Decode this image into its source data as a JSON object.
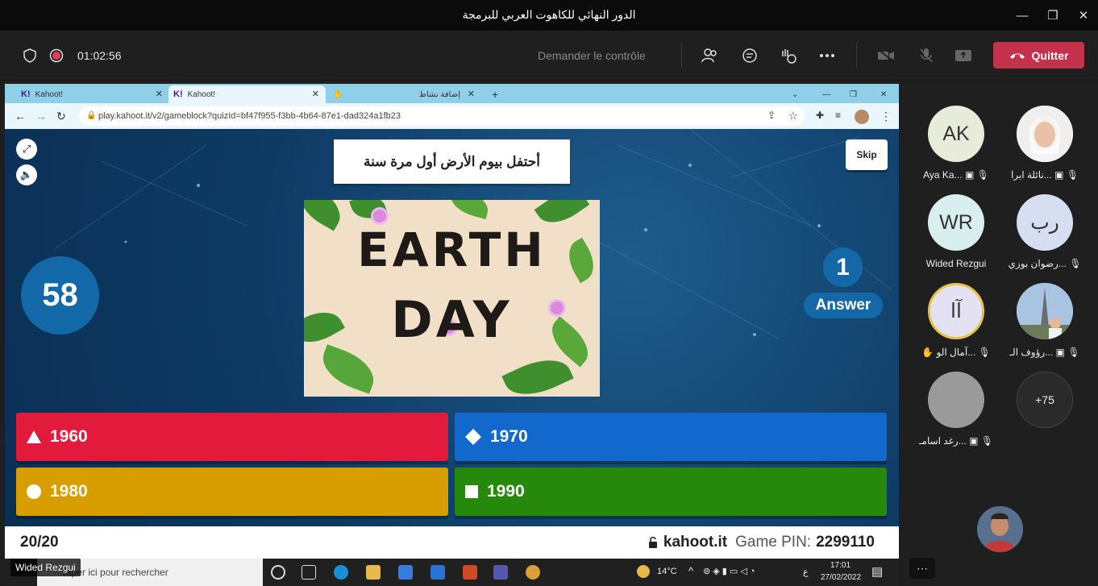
{
  "window": {
    "title": "الدور النهائي للكاهوت العربي للبرمجة"
  },
  "meeting": {
    "timer": "01:02:56",
    "request_control": "Demander le contrôle",
    "quit_label": "Quitter"
  },
  "browser": {
    "tabs": [
      {
        "label": "Kahoot!"
      },
      {
        "label": "Kahoot!"
      },
      {
        "label": "إضافة نشاط"
      }
    ],
    "url": "play.kahoot.it/v2/gameblock?quizId=bf47f955-f3bb-4b64-87e1-dad324a1fb23"
  },
  "kahoot": {
    "question": "أحتفل بيوم الأرض أول مرة سنة",
    "skip_label": "Skip",
    "timer_value": "58",
    "answer_count": "1",
    "answer_label": "Answer",
    "image_words": [
      "EARTH",
      "DAY"
    ],
    "answers": [
      {
        "text": "1960",
        "shape": "triangle-icon",
        "color": "#e21b3c"
      },
      {
        "text": "1970",
        "shape": "diamond-icon",
        "color": "#1368ce"
      },
      {
        "text": "1980",
        "shape": "circle-icon",
        "color": "#d89e00"
      },
      {
        "text": "1990",
        "shape": "square-icon",
        "color": "#26890c"
      }
    ],
    "question_count": "20/20",
    "site": "kahoot.it",
    "game_pin_label": "Game PIN:",
    "game_pin": "2299110"
  },
  "taskbar": {
    "search_placeholder": "Taper ici pour rechercher",
    "temperature": "14°C",
    "lang": "ع",
    "time": "17:01",
    "date": "27/02/2022"
  },
  "presenter_name": "Wided Rezgui",
  "participants": [
    {
      "initials": "",
      "name": "نائلة ابرا...",
      "bg": "#f2f2f2",
      "photo": true
    },
    {
      "initials": "AK",
      "name": "Aya Ka...",
      "bg": "#e6ecd9"
    },
    {
      "initials": "رب",
      "name": "رضوان بوزي...",
      "bg": "#d6dff2"
    },
    {
      "initials": "WR",
      "name": "Wided Rezgui",
      "bg": "#d9efef"
    },
    {
      "initials": "",
      "name": "رؤوف الـ...",
      "bg": "#9bb8d6",
      "photo": true
    },
    {
      "initials": "آا",
      "name": "آمال الو...",
      "bg": "#e4e2f2",
      "raised": true
    },
    {
      "initials": "+75",
      "name": "",
      "bg": "#2a2a2a"
    },
    {
      "initials": "",
      "name": "رغد اسامـ...",
      "bg": "#9a9a9a"
    }
  ],
  "colors": {
    "accent_quit": "#c4314b",
    "kahoot_blue": "#1369a8"
  }
}
